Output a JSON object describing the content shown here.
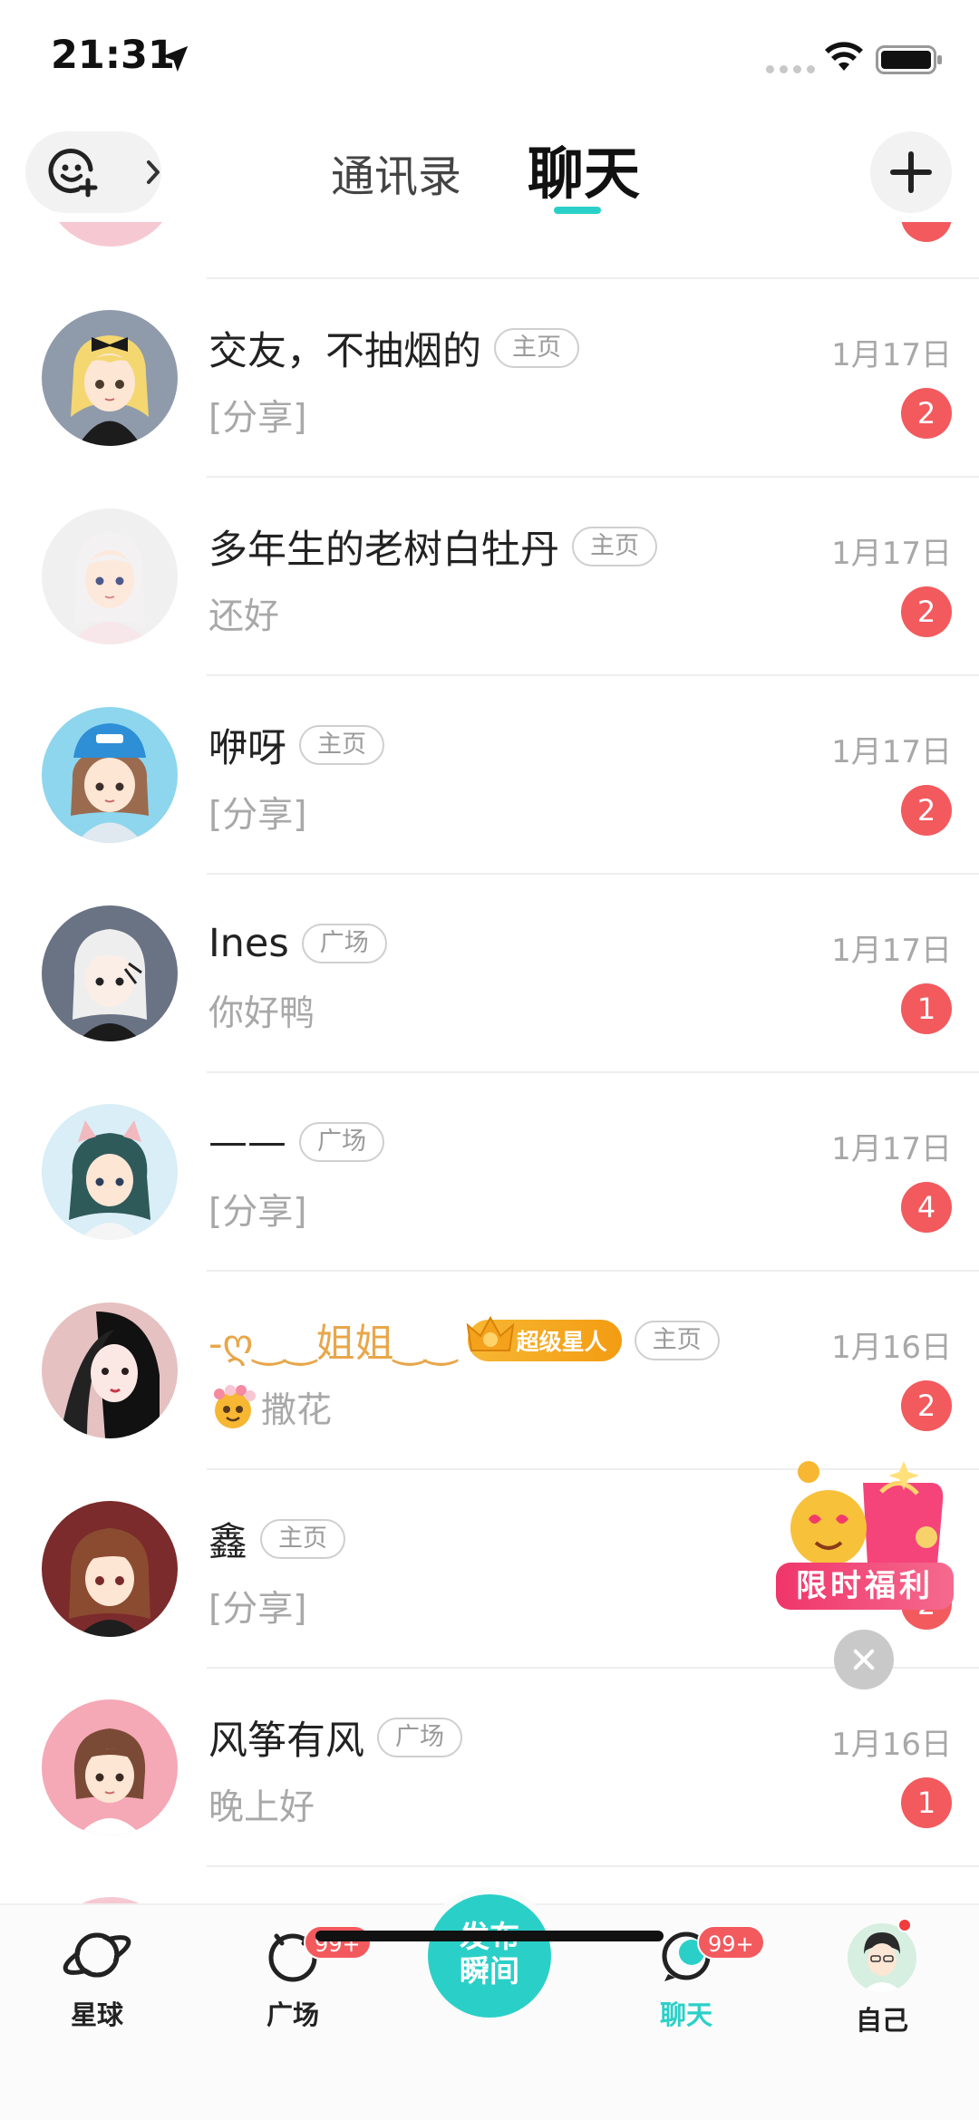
{
  "status_bar": {
    "time": "21:31"
  },
  "header": {
    "tab_contacts": "通讯录",
    "tab_chat": "聊天"
  },
  "chats": [
    {
      "name": "交友，不抽烟的",
      "tag": "主页",
      "date": "1月17日",
      "preview": "[分享]",
      "unread": "2"
    },
    {
      "name": "多年生的老树白牡丹",
      "tag": "主页",
      "date": "1月17日",
      "preview": "还好",
      "unread": "2"
    },
    {
      "name": "咿呀",
      "tag": "主页",
      "date": "1月17日",
      "preview": "[分享]",
      "unread": "2"
    },
    {
      "name": "Ines",
      "tag": "广场",
      "date": "1月17日",
      "preview": "你好鸭",
      "unread": "1"
    },
    {
      "name": "——",
      "tag": "广场",
      "date": "1月17日",
      "preview": "[分享]",
      "unread": "4"
    },
    {
      "name": "-ღ‿‿姐姐‿‿",
      "badge": "超级星人",
      "tag": "主页",
      "date": "1月16日",
      "preview": "撒花",
      "unread": "2"
    },
    {
      "name": "鑫",
      "tag": "主页",
      "date": "",
      "preview": "[分享]",
      "unread": "2"
    },
    {
      "name": "风筝有风",
      "tag": "广场",
      "date": "1月16日",
      "preview": "晚上好",
      "unread": "1"
    }
  ],
  "promo": {
    "label": "限时福利"
  },
  "tab_bar": {
    "planet": "星球",
    "square": "广场",
    "square_badge": "99+",
    "publish": "发布瞬间",
    "publish_line1": "发布",
    "publish_line2": "瞬间",
    "chat": "聊天",
    "chat_badge": "99+",
    "self": "自己"
  },
  "colors": {
    "accent": "#2ad0c8",
    "badge": "#f25a5e",
    "star": "#f39c12"
  }
}
